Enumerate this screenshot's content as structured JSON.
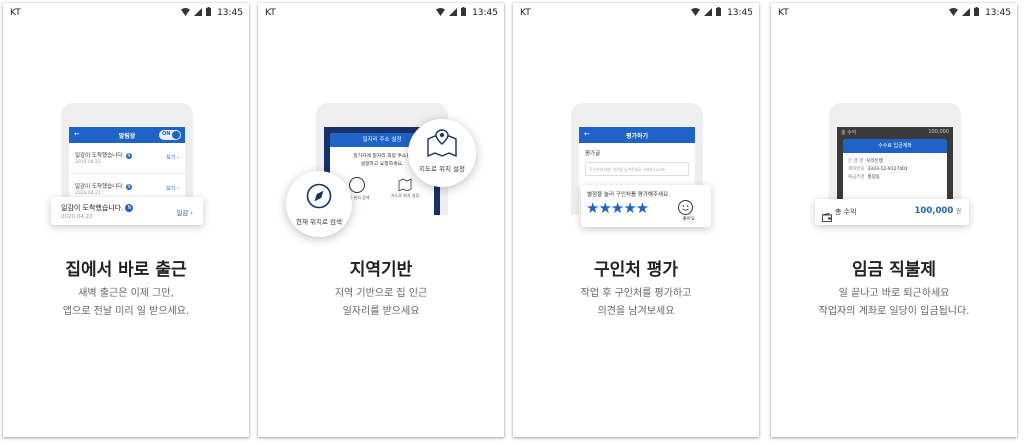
{
  "status": {
    "carrier": "KT",
    "time": "13:45"
  },
  "screens": [
    {
      "title": "집에서 바로 출근",
      "desc1": "새벽 출근은 이제 그만,",
      "desc2": "앱으로 전날 미리 일 받으세요.",
      "appbar_title": "알림장",
      "toggle": "ON",
      "rows": [
        {
          "msg": "일감이 도착했습니다.",
          "date": "2020.04.22",
          "action": "보기"
        },
        {
          "msg": "일감이 도착했습니다.",
          "date": "2020.04.21",
          "action": "보기"
        }
      ],
      "badge": "N",
      "card": {
        "msg": "일감이 도착했습니다.",
        "date": "2020.04.22",
        "action": "일감"
      }
    },
    {
      "title": "지역기반",
      "desc1": "지역 기반으로 집 인근",
      "desc2": "일자리를 받으세요",
      "dialog_title": "일자리 주소 설정",
      "dialog_line1": "일거자에 일자리 희망 주소를",
      "dialog_line2": "설정하고 요청하세요.",
      "btn_current": "현재 위치 검색",
      "btn_map": "지도로 위치 설정",
      "circle_current": "현재 위치로 검색",
      "circle_map": "지도로 위치 설정"
    },
    {
      "title": "구인처 평가",
      "desc1": "작업 후 구인처를 평가하고",
      "desc2": "의견을 남겨보세요",
      "appbar_title": "평가하기",
      "label": "평가글",
      "placeholder": "구인처에 대한 의견을 남겨주세요. (최대 100자)",
      "card_text": "별점을 눌러 구인처를 평가해주세요.",
      "stars": "★★★★★",
      "rating": 5,
      "face_label": "좋아요"
    },
    {
      "title": "임금 직불제",
      "desc1": "일 끝나고 바로 퇴근하세요",
      "desc2": "작업자의 계좌로 일당이 입금됩니다.",
      "bg_label": "총 수익",
      "bg_amount": "100,000",
      "sheet_title": "수수료 입금계좌",
      "fields": [
        {
          "k": "은 행 명",
          "v": "우리은행"
        },
        {
          "k": "계좌번호",
          "v": "3333-12-9127401"
        },
        {
          "k": "예금주명",
          "v": "홍길동"
        }
      ],
      "card_label": "총 수익",
      "card_amount": "100,000",
      "card_unit": "원"
    }
  ]
}
